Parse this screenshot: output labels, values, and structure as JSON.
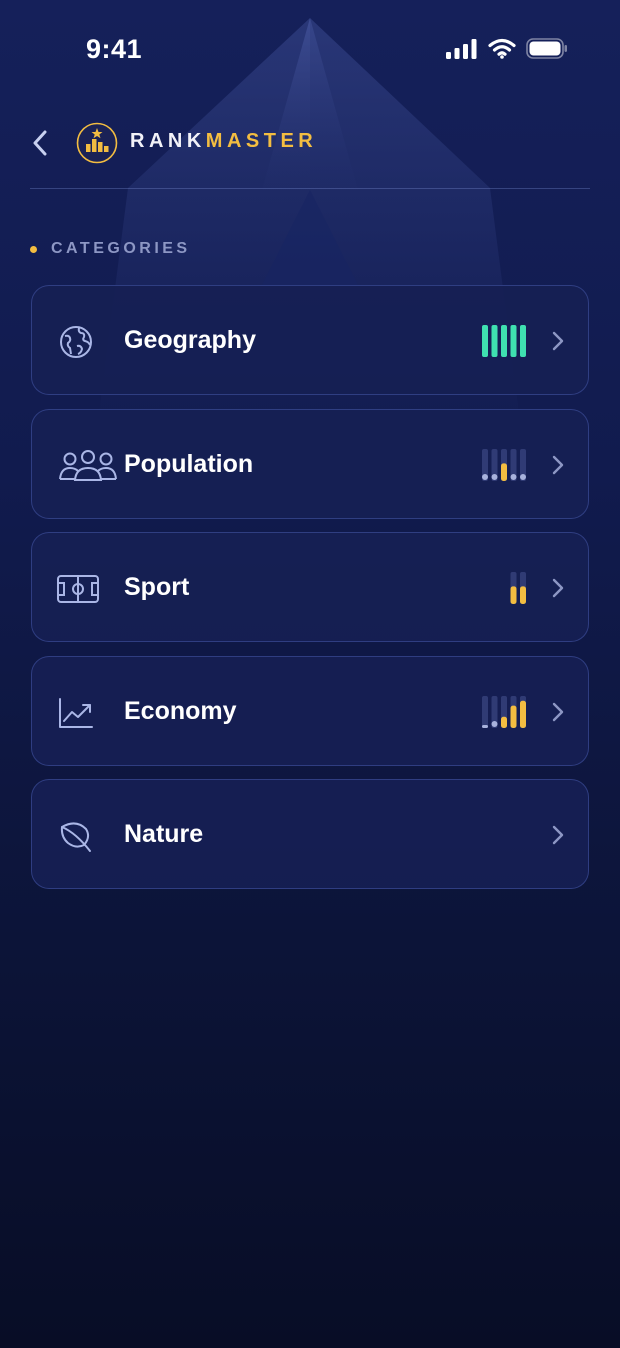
{
  "status_bar": {
    "time": "9:41"
  },
  "header": {
    "brand_part1": "RANK",
    "brand_part2": "MASTER"
  },
  "section": {
    "label": "CATEGORIES"
  },
  "colors": {
    "accent_gold": "#f3bd41",
    "accent_green": "#3fe0b0",
    "muted_bar": "#3a4680",
    "muted_dot": "#a8b2dc",
    "icon_stroke": "#aab6e6"
  },
  "categories": [
    {
      "label": "Geography",
      "icon": "globe-icon",
      "difficulty": [
        {
          "state": "on",
          "color": "green"
        },
        {
          "state": "on",
          "color": "green"
        },
        {
          "state": "on",
          "color": "green"
        },
        {
          "state": "on",
          "color": "green"
        },
        {
          "state": "on",
          "color": "green"
        }
      ]
    },
    {
      "label": "Population",
      "icon": "people-icon",
      "difficulty": [
        {
          "state": "dot",
          "color": "muted"
        },
        {
          "state": "dot",
          "color": "muted"
        },
        {
          "state": "half",
          "color": "gold"
        },
        {
          "state": "dot",
          "color": "muted"
        },
        {
          "state": "dot",
          "color": "muted"
        }
      ]
    },
    {
      "label": "Sport",
      "icon": "stadium-icon",
      "difficulty": [
        {
          "state": "half",
          "color": "gold"
        },
        {
          "state": "half",
          "color": "gold"
        }
      ]
    },
    {
      "label": "Economy",
      "icon": "trend-chart-icon",
      "difficulty": [
        {
          "state": "dash",
          "color": "muted"
        },
        {
          "state": "dot",
          "color": "muted"
        },
        {
          "state": "low",
          "color": "gold"
        },
        {
          "state": "mid",
          "color": "gold"
        },
        {
          "state": "high",
          "color": "gold"
        }
      ]
    },
    {
      "label": "Nature",
      "icon": "leaf-icon",
      "difficulty": []
    }
  ]
}
